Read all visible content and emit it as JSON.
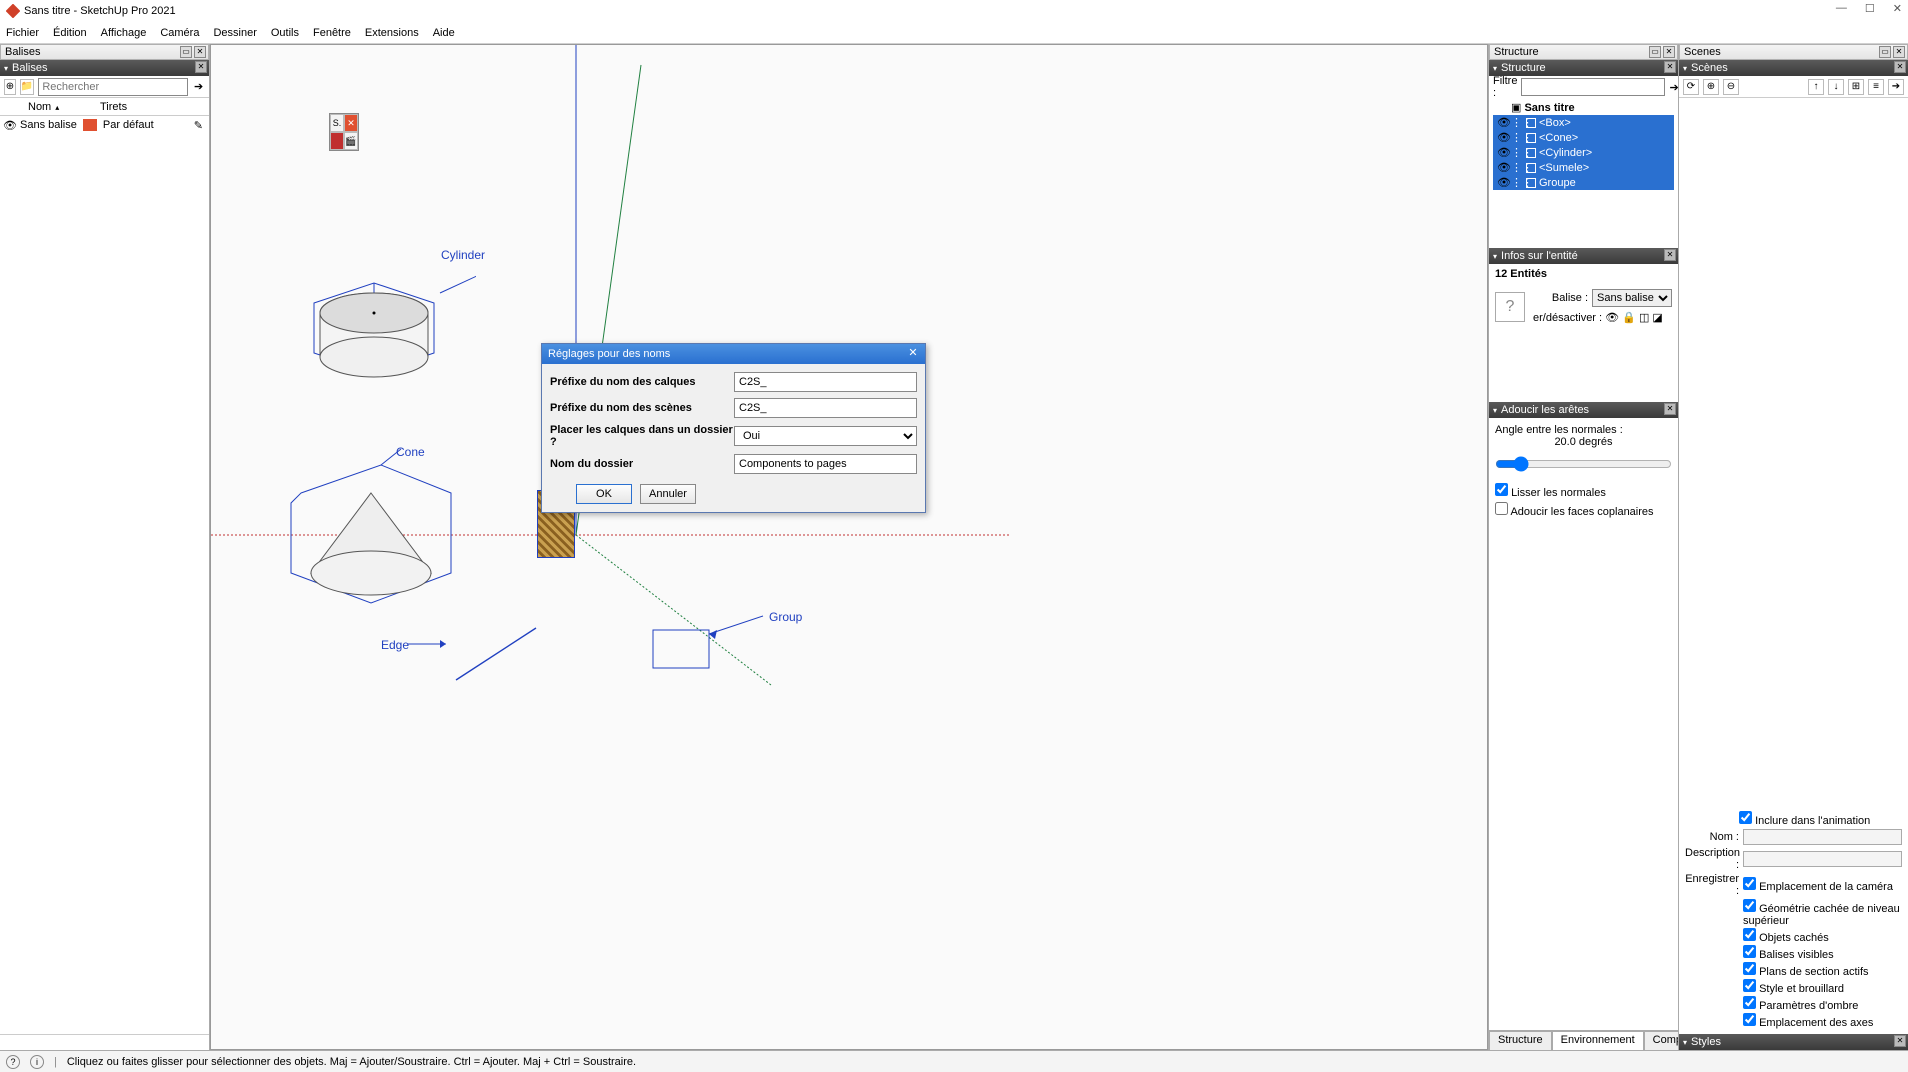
{
  "window": {
    "title": "Sans titre - SketchUp Pro 2021"
  },
  "menu": [
    "Fichier",
    "Édition",
    "Affichage",
    "Caméra",
    "Dessiner",
    "Outils",
    "Fenêtre",
    "Extensions",
    "Aide"
  ],
  "left": {
    "panel_title": "Balises",
    "tray_title": "Balises",
    "search_placeholder": "Rechercher",
    "col_name": "Nom",
    "col_dash": "Tirets",
    "row_name": "Sans balise",
    "row_dash": "Par défaut"
  },
  "viewport": {
    "labels": {
      "cylinder": "Cylinder",
      "cone": "Cone",
      "edge": "Edge",
      "group": "Group"
    }
  },
  "dialog": {
    "title": "Réglages pour des noms",
    "layer_prefix_label": "Préfixe du nom des calques",
    "layer_prefix_value": "C2S_",
    "scene_prefix_label": "Préfixe du nom des scènes",
    "scene_prefix_value": "C2S_",
    "folder_q_label": "Placer les calques dans un dossier ?",
    "folder_q_value": "Oui",
    "folder_name_label": "Nom du dossier",
    "folder_name_value": "Components to pages",
    "ok": "OK",
    "cancel": "Annuler"
  },
  "structure": {
    "panel_title": "Structure",
    "tray_title": "Structure",
    "filter_label": "Filtre :",
    "root": "Sans titre",
    "items": [
      "<Box>",
      "<Cone>",
      "<Cylinder>",
      "<Sumele>",
      "Groupe"
    ]
  },
  "entity": {
    "tray_title": "Infos sur l'entité",
    "count": "12 Entités",
    "balise_label": "Balise :",
    "balise_value": "Sans balise",
    "toggle_label": "er/désactiver :"
  },
  "soften": {
    "tray_title": "Adoucir les arêtes",
    "angle_label": "Angle entre les normales :",
    "angle_value": "20.0  degrés",
    "smooth": "Lisser les normales",
    "coplanar": "Adoucir les faces coplanaires"
  },
  "scenes": {
    "panel_title": "Scenes",
    "tray_title": "Scènes",
    "include": "Inclure dans l'animation",
    "name_label": "Nom :",
    "desc_label": "Description :",
    "save_label": "Enregistrer :",
    "opts": [
      "Emplacement de la caméra",
      "Géométrie cachée de niveau supérieur",
      "Objets cachés",
      "Balises visibles",
      "Plans de section actifs",
      "Style et brouillard",
      "Paramètres d'ombre",
      "Emplacement des axes"
    ],
    "styles_tray": "Styles"
  },
  "bottom_tabs": [
    "Structure",
    "Environnement",
    "Composant"
  ],
  "status": {
    "hint": "Cliquez ou faites glisser pour sélectionner des objets. Maj = Ajouter/Soustraire. Ctrl = Ajouter. Maj + Ctrl = Soustraire."
  }
}
